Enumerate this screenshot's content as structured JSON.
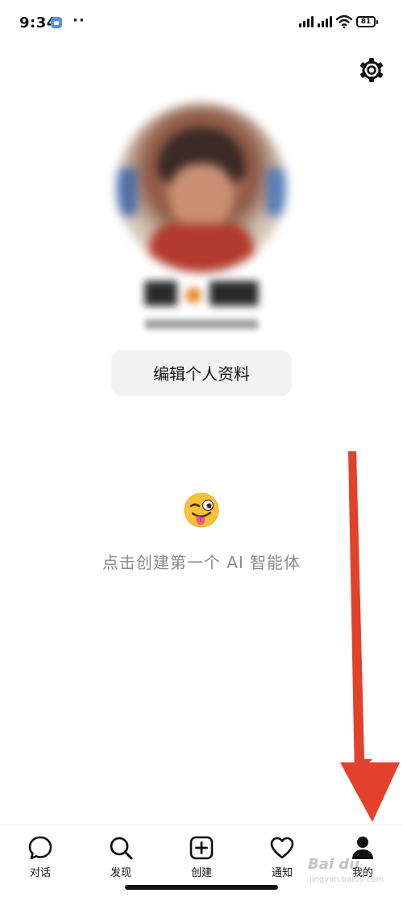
{
  "status_bar": {
    "time": "9:34",
    "dots": "··",
    "battery": "81"
  },
  "icons": {
    "settings": "gear-icon",
    "empty_state": "winking-tongue-emoji",
    "nav": [
      "chat-bubble-icon",
      "search-icon",
      "plus-square-icon",
      "heart-icon",
      "person-icon"
    ]
  },
  "profile": {
    "edit_button_label": "编辑个人资料"
  },
  "empty_state": {
    "text": "点击创建第一个 AI 智能体"
  },
  "bottom_nav": {
    "items": [
      {
        "label": "对话"
      },
      {
        "label": "发现"
      },
      {
        "label": "创建"
      },
      {
        "label": "通知"
      },
      {
        "label": "我的"
      }
    ]
  },
  "watermark": {
    "main": "Bai du",
    "sub": "jingyan.baidu.com"
  },
  "colors": {
    "annotation_arrow": "#e2412b",
    "button_bg": "#f2f2f2",
    "muted_text": "#8a8a8a"
  }
}
